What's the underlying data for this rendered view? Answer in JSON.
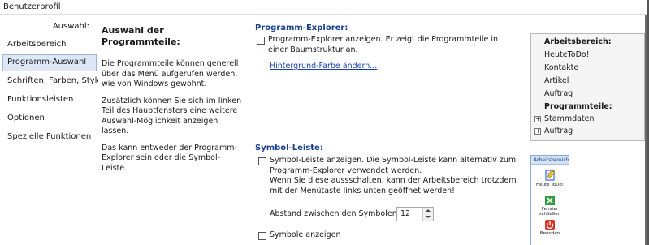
{
  "window": {
    "title": "Benutzerprofil"
  },
  "nav": {
    "header": "Auswahl:",
    "items": [
      {
        "label": "Arbeitsbereich"
      },
      {
        "label": "Programm-Auswahl"
      },
      {
        "label": "Schriften, Farben, Style"
      },
      {
        "label": "Funktionsleisten"
      },
      {
        "label": "Optionen"
      },
      {
        "label": "Spezielle Funktionen"
      }
    ]
  },
  "description": {
    "title": "Auswahl der Programmteile:",
    "paragraphs": [
      "Die Programmteile können generell über das Menü aufgerufen werden, wie von Windows gewohnt.",
      "Zusätzlich können Sie sich im linken Teil des Hauptfensters eine weitere Auswahl-Möglichkeit anzeigen lassen.",
      "Das kann entweder der Programm-Explorer sein oder die Symbol-Leiste."
    ]
  },
  "explorer": {
    "title": "Programm-Explorer:",
    "checkbox_text": "Programm-Explorer anzeigen. Er zeigt die Programmteile in einer Baumstruktur an.",
    "link": "Hintergrund-Farbe ändern...",
    "tree": [
      {
        "label": "Arbeitsbereich:",
        "bold": true,
        "expander": ""
      },
      {
        "label": "HeuteToDo!",
        "bold": false,
        "expander": ""
      },
      {
        "label": "Kontakte",
        "bold": false,
        "expander": ""
      },
      {
        "label": "Artikel",
        "bold": false,
        "expander": ""
      },
      {
        "label": "Auftrag",
        "bold": false,
        "expander": ""
      },
      {
        "label": "Programmteile:",
        "bold": true,
        "expander": ""
      },
      {
        "label": "Stammdaten",
        "bold": false,
        "expander": "+"
      },
      {
        "label": "Auftrag",
        "bold": false,
        "expander": "+"
      }
    ]
  },
  "symbolbar": {
    "title": "Symbol-Leiste:",
    "checkbox_text_1": "Symbol-Leiste anzeigen. Die Symbol-Leiste kann alternativ zum Programm-Explorer verwendet werden.",
    "checkbox_text_2": "Wenn Sie diese aussschalten, kann der Arbeitsbereich trotzdem mit der Menütaste links unten geöffnet werden!",
    "spacing_label": "Abstand zwischen den Symbolen:",
    "spacing_value": "12",
    "symbols_checkbox": "Symbole anzeigen",
    "preview": {
      "header": "Arbeitsbereich",
      "items": [
        {
          "label": "Heute ToDo!",
          "icon": "notepad-icon",
          "color": "#3a6fd0"
        },
        {
          "label": "Fenster schließen",
          "icon": "close-windows-icon",
          "color": "#2e9e3a"
        },
        {
          "label": "Beenden",
          "icon": "power-icon",
          "color": "#d8352b"
        }
      ]
    }
  },
  "colors": {
    "accent": "#1b3f8f",
    "nav_active_bg": "#dde8f7",
    "link": "#1a3faf"
  }
}
